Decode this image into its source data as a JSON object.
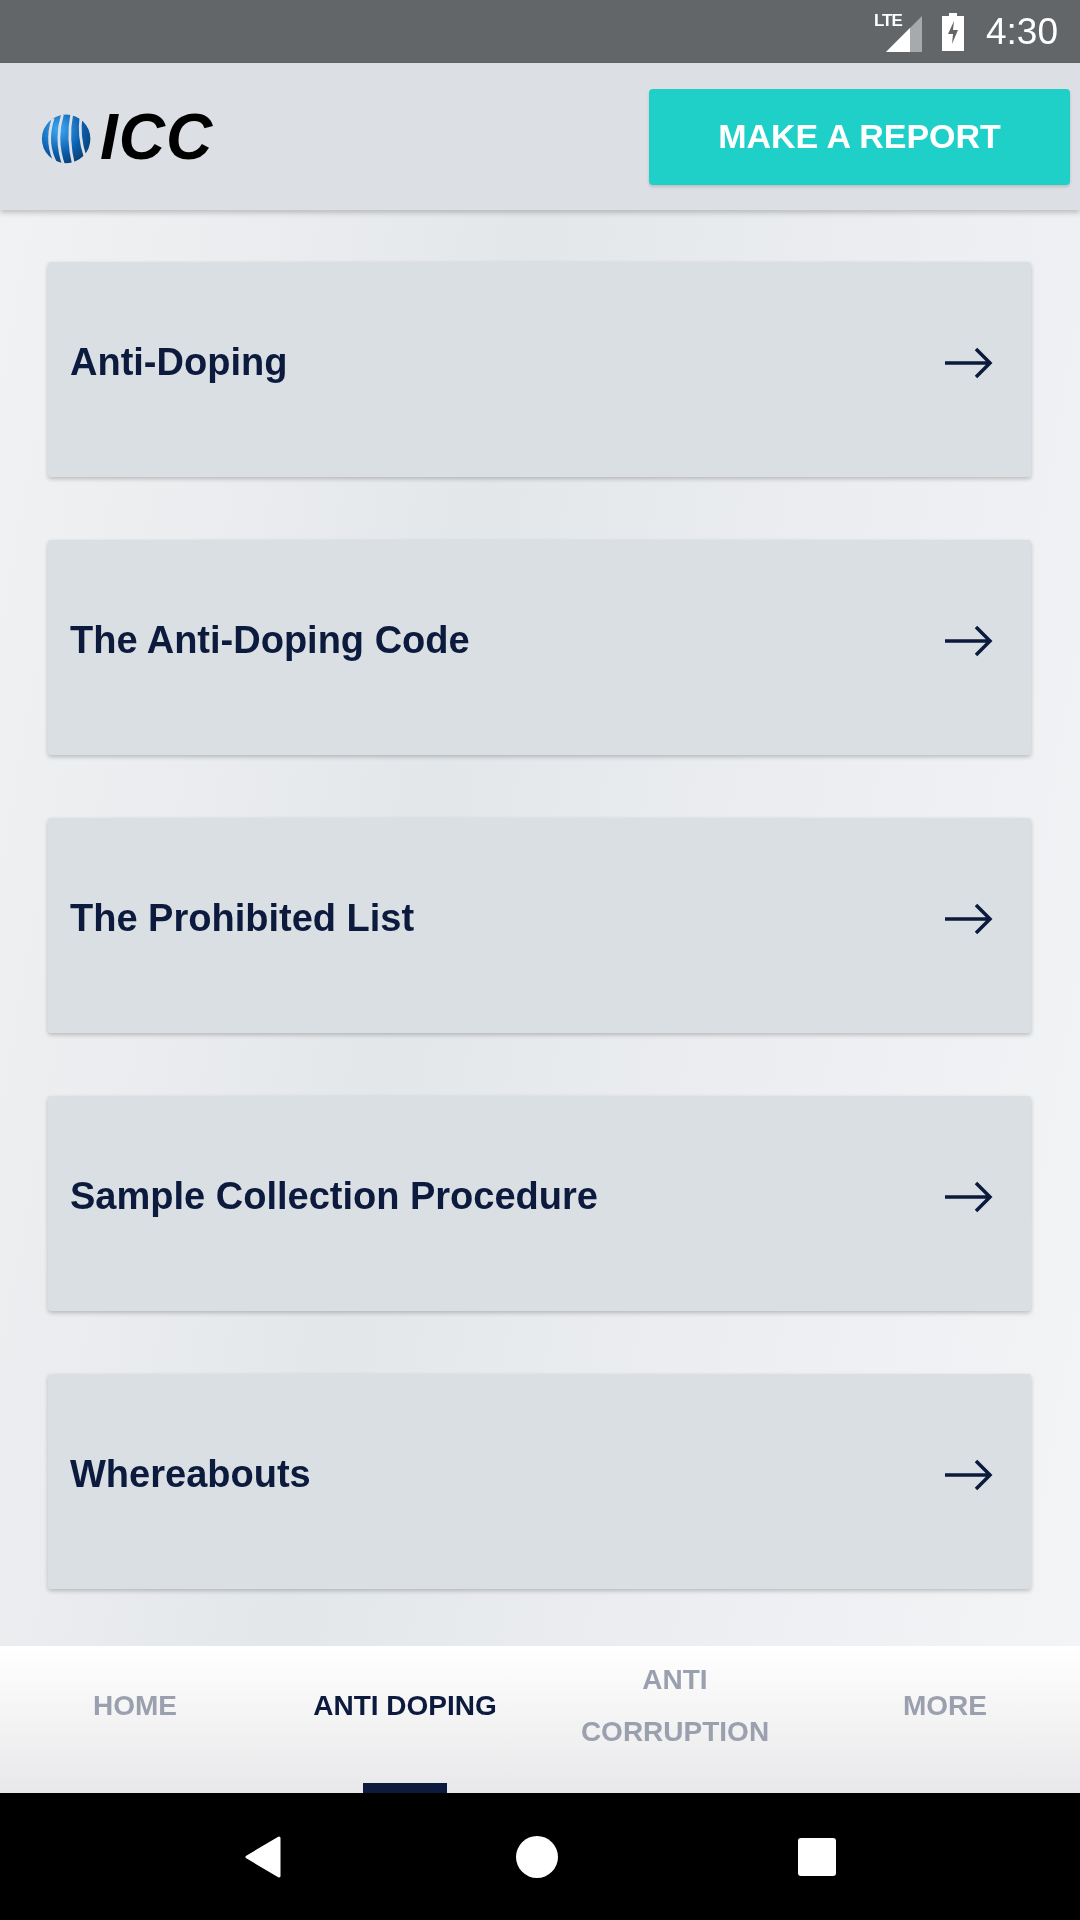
{
  "status_bar": {
    "network": "LTE",
    "time": "4:30"
  },
  "header": {
    "logo_text": "ICC",
    "report_button": "MAKE A REPORT"
  },
  "menu_items": [
    {
      "label": "Anti-Doping"
    },
    {
      "label": "The Anti-Doping Code"
    },
    {
      "label": "The Prohibited List"
    },
    {
      "label": "Sample Collection Procedure"
    },
    {
      "label": "Whereabouts"
    }
  ],
  "tabs": [
    {
      "label": "HOME",
      "selected": false
    },
    {
      "label": "ANTI DOPING",
      "selected": true
    },
    {
      "label": "ANTI CORRUPTION",
      "selected": false
    },
    {
      "label": "MORE",
      "selected": false
    }
  ]
}
